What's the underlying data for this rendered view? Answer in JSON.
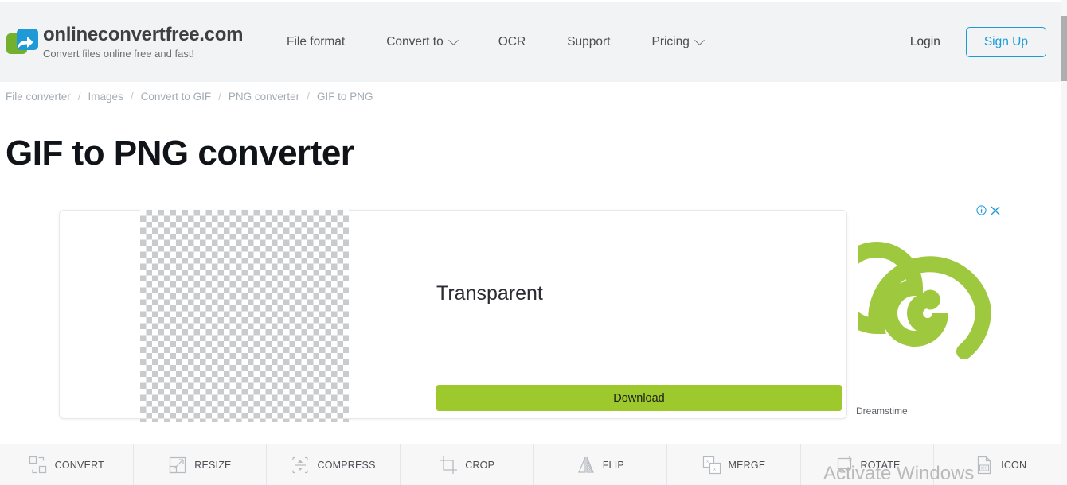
{
  "header": {
    "logo": {
      "title": "onlineconvertfree.com",
      "tagline": "Convert files online free and fast!",
      "icon": "convert-arrow-logo"
    },
    "nav": [
      {
        "label": "File format",
        "has_caret": false
      },
      {
        "label": "Convert to",
        "has_caret": true
      },
      {
        "label": "OCR",
        "has_caret": false
      },
      {
        "label": "Support",
        "has_caret": false
      },
      {
        "label": "Pricing",
        "has_caret": true
      }
    ],
    "login_label": "Login",
    "signup_label": "Sign Up",
    "signup_accent_color": "#1a9ad6",
    "background_color": "#f1f3f4"
  },
  "breadcrumb": {
    "separator": "/",
    "items": [
      "File converter",
      "Images",
      "Convert to GIF",
      "PNG converter",
      "GIF to PNG"
    ]
  },
  "page": {
    "title": "GIF to PNG converter"
  },
  "result_card": {
    "preview_label": "Transparent",
    "download_label": "Download",
    "download_color": "#9ec92c",
    "checker_color": "#c9cbcd"
  },
  "ad": {
    "info_icon": "info-circle-icon",
    "close_icon": "close-x-icon",
    "image_icon": "green-spiral-logo",
    "image_color": "#9ec93f",
    "caption": "Dreamstime",
    "controls_accent_color": "#1a9ad6"
  },
  "toolbar": {
    "items": [
      {
        "label": "CONVERT",
        "icon": "convert-squares-icon"
      },
      {
        "label": "RESIZE",
        "icon": "resize-diagonal-icon"
      },
      {
        "label": "COMPRESS",
        "icon": "compress-arrows-icon"
      },
      {
        "label": "CROP",
        "icon": "crop-frame-icon"
      },
      {
        "label": "FLIP",
        "icon": "flip-mirror-icon"
      },
      {
        "label": "MERGE",
        "icon": "merge-squares-icon"
      },
      {
        "label": "ROTATE",
        "icon": "rotate-square-icon"
      },
      {
        "label": "ICON",
        "icon": "ico-file-icon"
      }
    ],
    "background_color": "#f7f7f8"
  },
  "watermark": {
    "text": "Activate Windows"
  },
  "scrollbar": {
    "orientation": "vertical"
  }
}
